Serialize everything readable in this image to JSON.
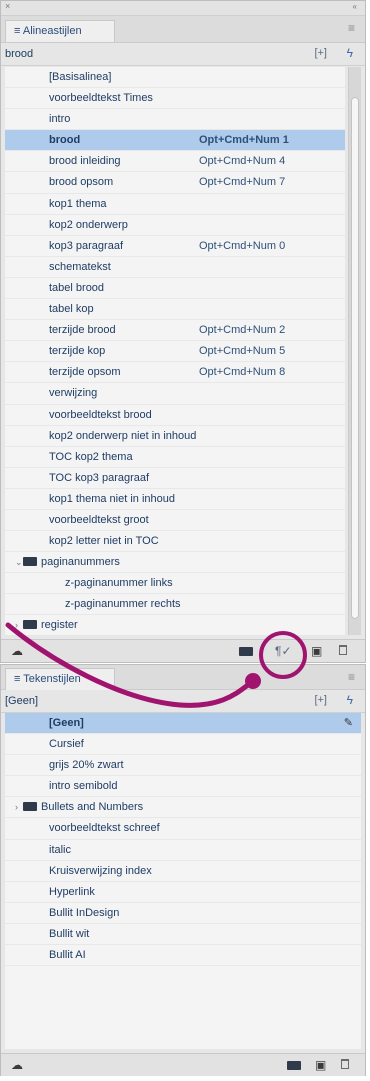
{
  "panel1": {
    "tab_label": "≡ Alineastijlen",
    "current_style": "brood",
    "items": [
      {
        "label": "[Basisalinea]",
        "shortcut": ""
      },
      {
        "label": "voorbeeldtekst Times",
        "shortcut": ""
      },
      {
        "label": "intro",
        "shortcut": ""
      },
      {
        "label": "brood",
        "shortcut": "Opt+Cmd+Num 1",
        "selected": true
      },
      {
        "label": "brood inleiding",
        "shortcut": "Opt+Cmd+Num 4"
      },
      {
        "label": "brood opsom",
        "shortcut": "Opt+Cmd+Num 7"
      },
      {
        "label": "kop1 thema",
        "shortcut": ""
      },
      {
        "label": "kop2 onderwerp",
        "shortcut": ""
      },
      {
        "label": "kop3 paragraaf",
        "shortcut": "Opt+Cmd+Num 0"
      },
      {
        "label": "schematekst",
        "shortcut": ""
      },
      {
        "label": "tabel brood",
        "shortcut": ""
      },
      {
        "label": "tabel kop",
        "shortcut": ""
      },
      {
        "label": "terzijde brood",
        "shortcut": "Opt+Cmd+Num 2"
      },
      {
        "label": "terzijde kop",
        "shortcut": "Opt+Cmd+Num 5"
      },
      {
        "label": "terzijde opsom",
        "shortcut": "Opt+Cmd+Num 8"
      },
      {
        "label": "verwijzing",
        "shortcut": ""
      },
      {
        "label": "voorbeeldtekst brood",
        "shortcut": ""
      },
      {
        "label": "kop2 onderwerp niet in inhoud",
        "shortcut": ""
      },
      {
        "label": "TOC kop2 thema",
        "shortcut": ""
      },
      {
        "label": "TOC kop3 paragraaf",
        "shortcut": ""
      },
      {
        "label": "kop1 thema niet in inhoud",
        "shortcut": ""
      },
      {
        "label": "voorbeeldtekst groot",
        "shortcut": ""
      },
      {
        "label": "kop2 letter niet in TOC",
        "shortcut": ""
      }
    ],
    "group_open": {
      "label": "paginanummers",
      "twisty": "⌄"
    },
    "sub_items": [
      {
        "label": "z-paginanummer links"
      },
      {
        "label": "z-paginanummer rechts"
      }
    ],
    "group_closed": {
      "label": "register",
      "twisty": "›"
    }
  },
  "panel2": {
    "tab_label": "≡ Tekenstijlen",
    "current_style": "[Geen]",
    "items": [
      {
        "label": "[Geen]",
        "selected": true
      },
      {
        "label": "Cursief"
      },
      {
        "label": "grijs 20% zwart"
      },
      {
        "label": "intro semibold"
      }
    ],
    "group": {
      "label": "Bullets and Numbers",
      "twisty": "›"
    },
    "items2": [
      {
        "label": "voorbeeldtekst schreef"
      },
      {
        "label": "italic"
      },
      {
        "label": "Kruisverwijzing index"
      },
      {
        "label": "Hyperlink"
      },
      {
        "label": "Bullit InDesign"
      },
      {
        "label": "Bullit wit"
      },
      {
        "label": "Bullit AI"
      }
    ]
  },
  "colors": {
    "selection": "#aecbeb",
    "annotation": "#a0136f",
    "text": "#1f3d64"
  },
  "icons": [
    "load-styles-icon",
    "new-group-icon",
    "clear-overrides-icon",
    "new-style-icon",
    "delete-icon",
    "panel-menu-icon",
    "quick-apply-icon",
    "lightning-icon"
  ]
}
